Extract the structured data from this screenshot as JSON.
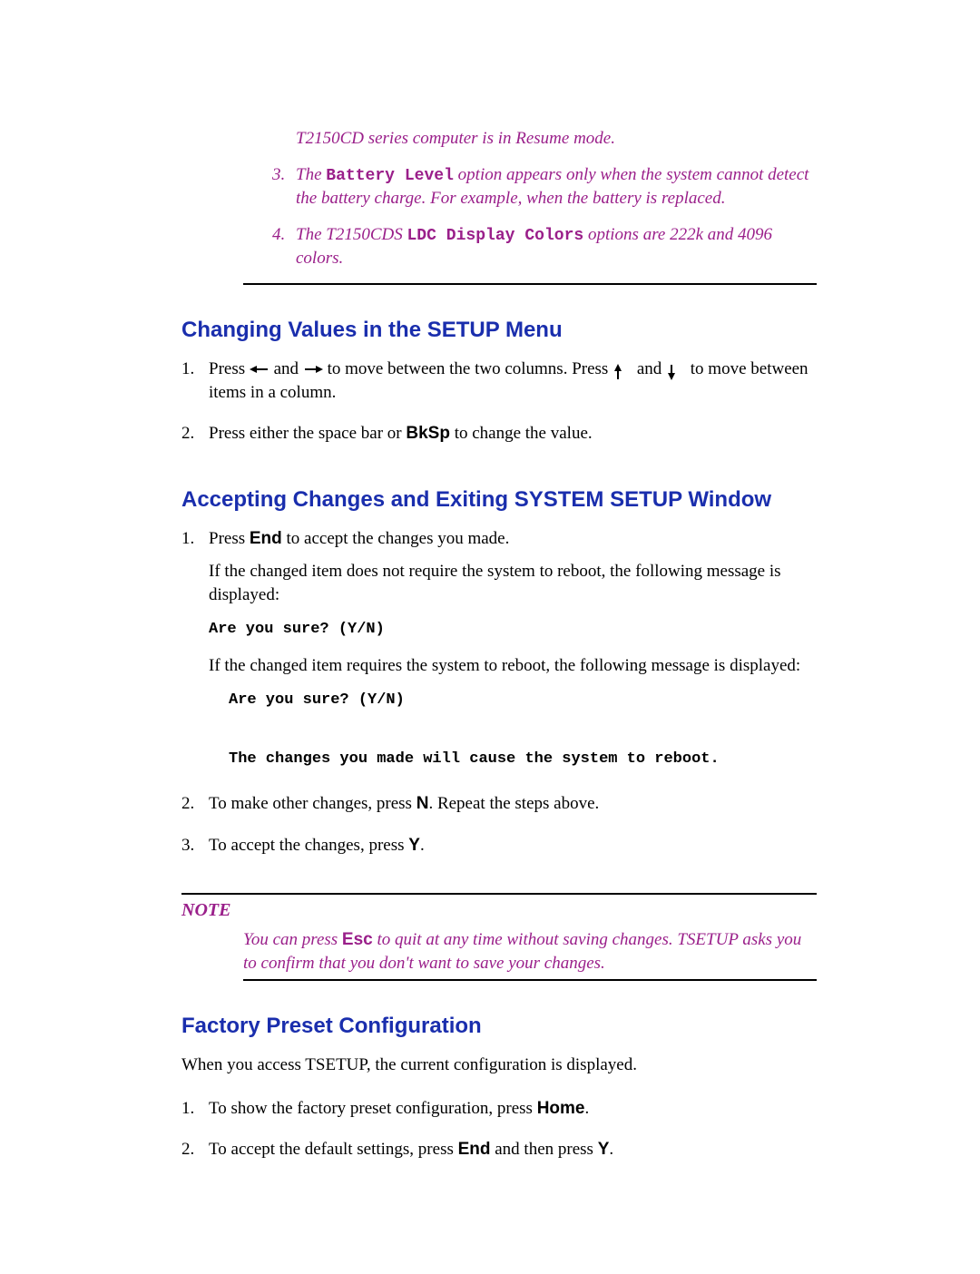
{
  "topNotes": {
    "resume": "T2150CD series computer is in Resume mode.",
    "item3": {
      "num": "3.",
      "pre": "The ",
      "code": "Battery Level",
      "post": " option appears only when the system cannot detect the battery charge. For example, when the battery is replaced."
    },
    "item4": {
      "num": "4.",
      "pre": "The T2150CDS ",
      "code": "LDC Display Colors",
      "post": " options are 222k and 4096 colors."
    }
  },
  "section1": {
    "heading": "Changing Values in the SETUP Menu",
    "steps": {
      "s1": {
        "num": "1.",
        "t1": "Press ",
        "t2": " and ",
        "t3": " to move between the two columns. Press ",
        "t4": " and ",
        "t5": " to move between items in a column."
      },
      "s2": {
        "num": "2.",
        "t1": "Press either the space bar or ",
        "key": "BkSp",
        "t2": " to change the value."
      }
    }
  },
  "section2": {
    "heading": "Accepting Changes and Exiting SYSTEM SETUP Window",
    "steps": {
      "s1": {
        "num": "1.",
        "t1": "Press ",
        "key": "End",
        "t2": " to accept the changes you made.",
        "p2": "If the changed item does not require the system to reboot, the following message is displayed:",
        "code1": "Are you sure? (Y/N)",
        "p3": "If the changed item requires the system to reboot, the following message is displayed:",
        "code2": "Are you sure? (Y/N)\n\nThe changes you made will cause the system to reboot."
      },
      "s2": {
        "num": "2.",
        "t1": "To make other changes, press ",
        "key": "N",
        "t2": ".  Repeat the steps above."
      },
      "s3": {
        "num": "3.",
        "t1": "To accept the changes, press ",
        "key": "Y",
        "t2": "."
      }
    },
    "note": {
      "label": "NOTE",
      "t1": "You can press ",
      "key": "Esc",
      "t2": " to quit at any time without saving changes. TSETUP asks you to confirm that you don't want to save your changes."
    }
  },
  "section3": {
    "heading": "Factory Preset Configuration",
    "intro": "When you access TSETUP, the current configuration is displayed.",
    "steps": {
      "s1": {
        "num": "1.",
        "t1": "To show the factory preset configuration, press ",
        "key": "Home",
        "t2": "."
      },
      "s2": {
        "num": "2.",
        "t1": "To accept the default settings, press ",
        "key1": "End",
        "t2": " and then press ",
        "key2": "Y",
        "t3": "."
      }
    }
  }
}
